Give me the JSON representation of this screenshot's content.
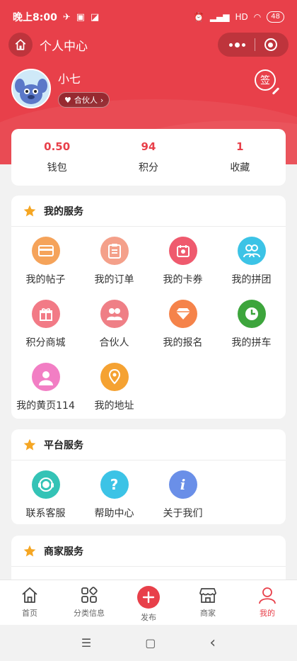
{
  "status_bar": {
    "time": "晚上8:00",
    "battery": "48",
    "hd": "HD"
  },
  "navbar": {
    "title": "个人中心"
  },
  "profile": {
    "name": "小七",
    "badge": "合伙人",
    "sign_label": "签"
  },
  "stats": [
    {
      "value": "0.50",
      "label": "钱包"
    },
    {
      "value": "94",
      "label": "积分"
    },
    {
      "value": "1",
      "label": "收藏"
    }
  ],
  "my_services": {
    "title": "我的服务",
    "items": [
      {
        "label": "我的帖子",
        "icon": "card-icon",
        "color": "#f5a35a"
      },
      {
        "label": "我的订单",
        "icon": "clipboard-icon",
        "color": "#f4a08a"
      },
      {
        "label": "我的卡券",
        "icon": "ticket-icon",
        "color": "#ef5a6e"
      },
      {
        "label": "我的拼团",
        "icon": "group-icon",
        "color": "#3cc3e6"
      },
      {
        "label": "积分商城",
        "icon": "gift-icon",
        "color": "#f27a86"
      },
      {
        "label": "合伙人",
        "icon": "partner-icon",
        "color": "#ef7f86"
      },
      {
        "label": "我的报名",
        "icon": "diamond-icon",
        "color": "#f5834a"
      },
      {
        "label": "我的拼车",
        "icon": "clock-icon",
        "color": "#3da53c"
      },
      {
        "label": "我的黄页114",
        "icon": "person-icon",
        "color": "#f27ec4"
      },
      {
        "label": "我的地址",
        "icon": "location-icon",
        "color": "#f5a232"
      }
    ]
  },
  "platform_services": {
    "title": "平台服务",
    "items": [
      {
        "label": "联系客服",
        "icon": "customer-service-icon",
        "color": "#34c3b6"
      },
      {
        "label": "帮助中心",
        "icon": "help-icon",
        "color": "#3cc3e6",
        "glyph": "?"
      },
      {
        "label": "关于我们",
        "icon": "info-icon",
        "color": "#6a8fe8",
        "glyph": "i"
      }
    ]
  },
  "merchant_services": {
    "title": "商家服务"
  },
  "tabbar": [
    {
      "label": "首页",
      "icon": "home-icon"
    },
    {
      "label": "分类信息",
      "icon": "category-icon"
    },
    {
      "label": "发布",
      "icon": "publish-icon"
    },
    {
      "label": "商家",
      "icon": "store-icon"
    },
    {
      "label": "我的",
      "icon": "user-icon",
      "active": true
    }
  ],
  "system_nav": {
    "menu": "☰",
    "home": "▢",
    "back": "‹"
  }
}
